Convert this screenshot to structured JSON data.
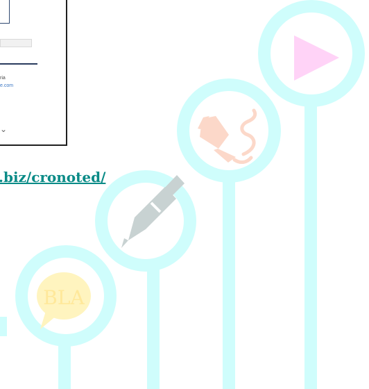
{
  "screenshot_preview": {
    "text_line_1": "ria",
    "text_line_2": "e.com",
    "scroll_glyph": "⌄"
  },
  "link": {
    "text": ".biz/cronoted/"
  },
  "decor": {
    "circle_color": "#CFFDFC",
    "speech_bubble_text": "BLA",
    "icons": [
      "speech-bubble-icon",
      "pen-icon",
      "fountain-pen-icon",
      "play-icon"
    ]
  }
}
